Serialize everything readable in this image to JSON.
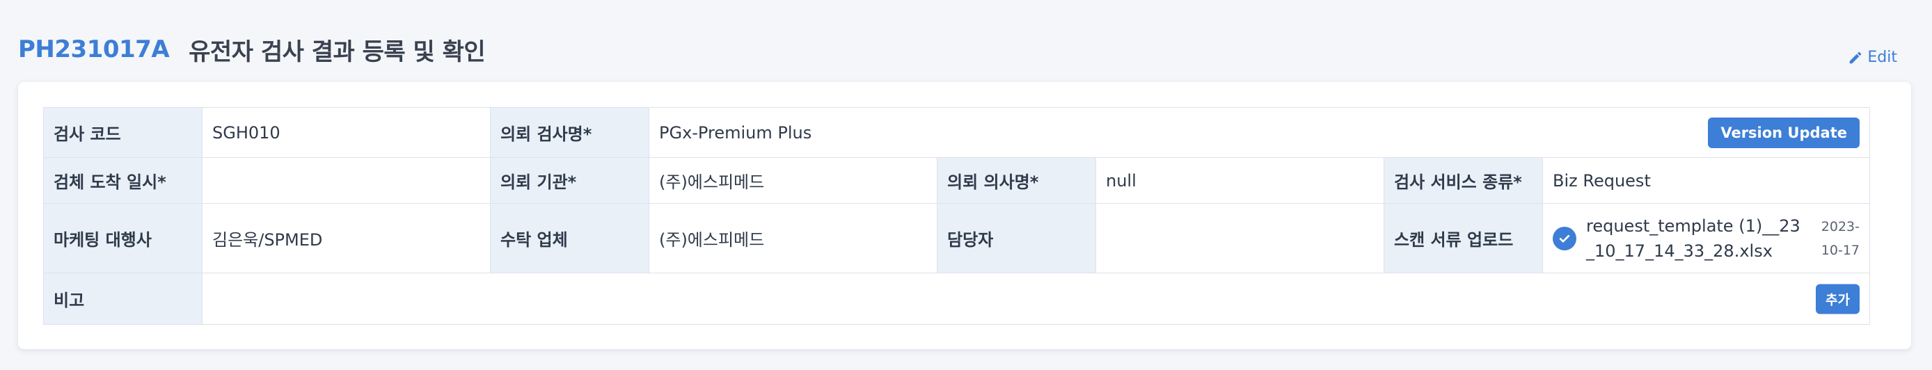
{
  "header": {
    "id": "PH231017A",
    "title": "유전자 검사 결과 등록 및 확인",
    "edit_label": "Edit"
  },
  "fields": {
    "test_code": {
      "label": "검사 코드",
      "value": "SGH010"
    },
    "requested_test_name": {
      "label": "의뢰 검사명*",
      "value": "PGx-Premium Plus"
    },
    "version_update_label": "Version Update",
    "specimen_arrival": {
      "label": "검체 도착 일시*",
      "value": ""
    },
    "requesting_institution": {
      "label": "의뢰 기관*",
      "value": "(주)에스피메드"
    },
    "requesting_doctor": {
      "label": "의뢰 의사명*",
      "value": "null"
    },
    "service_type": {
      "label": "검사 서비스 종류*",
      "value": "Biz Request"
    },
    "marketing_agency": {
      "label": "마케팅 대행사",
      "value": "김은욱/SPMED"
    },
    "contractor": {
      "label": "수탁 업체",
      "value": "(주)에스피메드"
    },
    "manager": {
      "label": "담당자",
      "value": ""
    },
    "scan_upload": {
      "label": "스캔 서류 업로드",
      "file_name": "request_template (1)__23_10_17_14_33_28.xlsx",
      "file_date": "2023-10-17",
      "icon": "check-circle-icon"
    },
    "remarks": {
      "label": "비고",
      "value": ""
    },
    "add_label": "추가"
  },
  "colors": {
    "accent": "#3d7ed6",
    "label_bg": "#e9f0f8",
    "border": "#dde3ec",
    "page_bg": "#f4f6fa"
  }
}
